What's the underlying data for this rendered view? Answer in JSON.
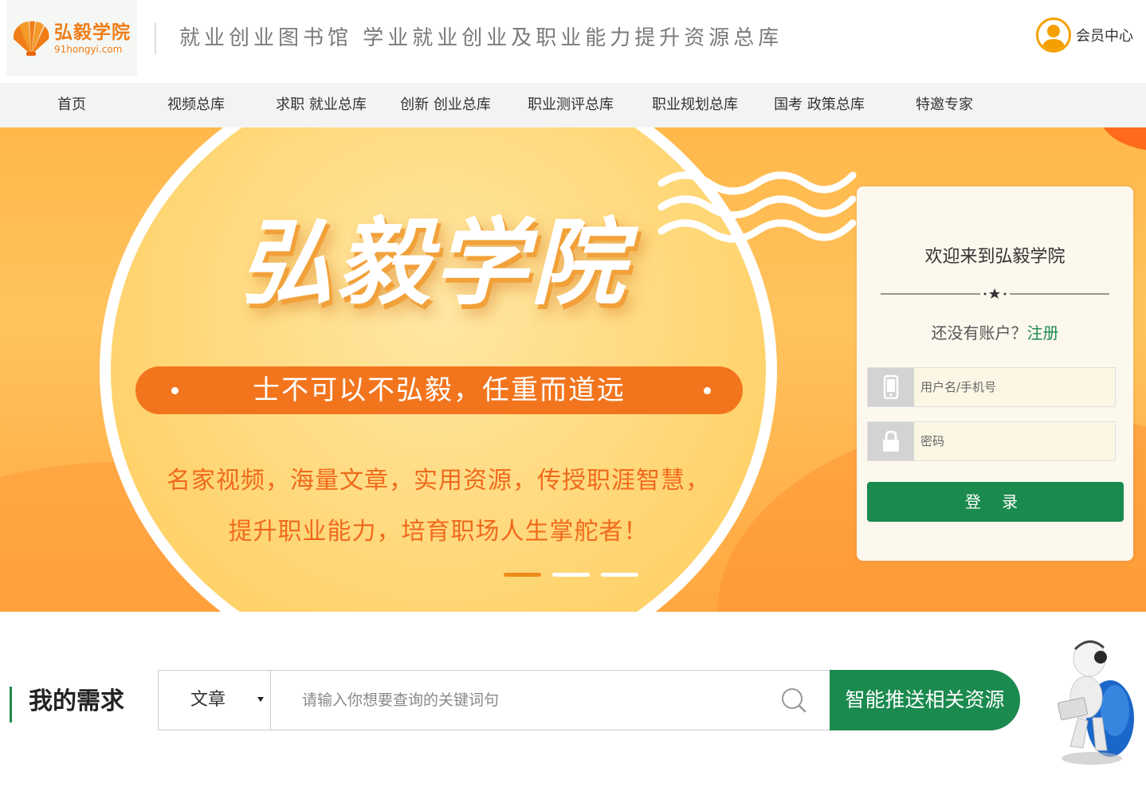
{
  "header": {
    "logo_cn": "弘毅学院",
    "logo_en": "91hongyi.com",
    "tagline": "就业创业图书馆  学业就业创业及职业能力提升资源总库",
    "member_label": "会员中心"
  },
  "nav": {
    "items": [
      {
        "label": "首页"
      },
      {
        "label": "视频总库"
      },
      {
        "label": "求职 就业总库"
      },
      {
        "label": "创新 创业总库"
      },
      {
        "label": "职业测评总库"
      },
      {
        "label": "职业规划总库"
      },
      {
        "label": "国考 政策总库"
      },
      {
        "label": "特邀专家"
      }
    ]
  },
  "banner": {
    "title": "弘毅学院",
    "slogan": "士不可以不弘毅，任重而道远",
    "desc_line1": "名家视频，海量文章，实用资源，传授职涯智慧，",
    "desc_line2": "提升职业能力，培育职场人生掌舵者！",
    "slide_count": 3,
    "active_slide": 1
  },
  "login": {
    "welcome": "欢迎来到弘毅学院",
    "no_account": "还没有账户？",
    "register": "注册",
    "username_placeholder": "用户名/手机号",
    "password_placeholder": "密码",
    "login_button": "登 录"
  },
  "need": {
    "title": "我的需求",
    "select_value": "文章",
    "search_placeholder": "请输入你想要查询的关键词句",
    "push_button": "智能推送相关资源"
  },
  "colors": {
    "brand_orange": "#f07d16",
    "brand_green": "#1a8a4e",
    "banner_bg": "#ffc35e",
    "slogan_pill": "#f2751e"
  },
  "icons": {
    "logo": "shell-logo-icon",
    "member": "user-avatar-icon",
    "username": "phone-icon",
    "password": "lock-icon",
    "search": "search-icon",
    "mascot": "mascot-figure"
  }
}
